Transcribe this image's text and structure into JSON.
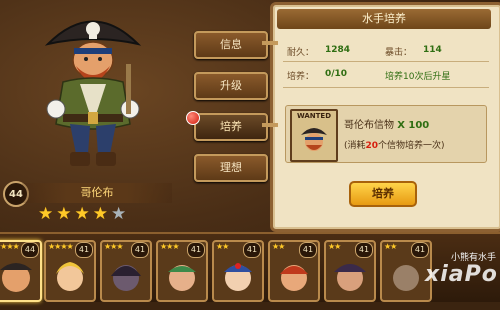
{
  "hero": {
    "level": "44",
    "name": "哥伦布",
    "stars": 4,
    "max_stars": 5
  },
  "menu": {
    "items": [
      "信息",
      "升级",
      "培养",
      "理想"
    ],
    "active_index": 2
  },
  "panel": {
    "title": "水手培养",
    "durability_label": "耐久：",
    "durability_value": "1284",
    "crit_label": "暴击：",
    "crit_value": "114",
    "train_label": "培养：",
    "train_value": "0/10",
    "train_note": "培养10次后升星",
    "wanted_label": "WANTED",
    "item_name": "哥伦布信物",
    "item_count": "X 100",
    "cost_prefix": "(消耗",
    "cost_amount": "20",
    "cost_suffix": "个信物培养一次)",
    "button_label": "培养"
  },
  "roster": {
    "cards": [
      {
        "level": "44",
        "stars": "★★★★"
      },
      {
        "level": "41",
        "stars": "★★★★"
      },
      {
        "level": "41",
        "stars": "★★★"
      },
      {
        "level": "41",
        "stars": "★★★"
      },
      {
        "level": "41",
        "stars": "★★"
      },
      {
        "level": "41",
        "stars": "★★"
      },
      {
        "level": "41",
        "stars": "★★"
      },
      {
        "level": "41",
        "stars": "★★"
      }
    ]
  },
  "watermark": {
    "text": "小熊有水手",
    "brand": "xiaPo"
  },
  "colors": {
    "panel_bg": "#f0e3c3",
    "highlight_green": "#2f6e12",
    "cost_red": "#d61e0e",
    "star_gold": "#ffc928"
  }
}
